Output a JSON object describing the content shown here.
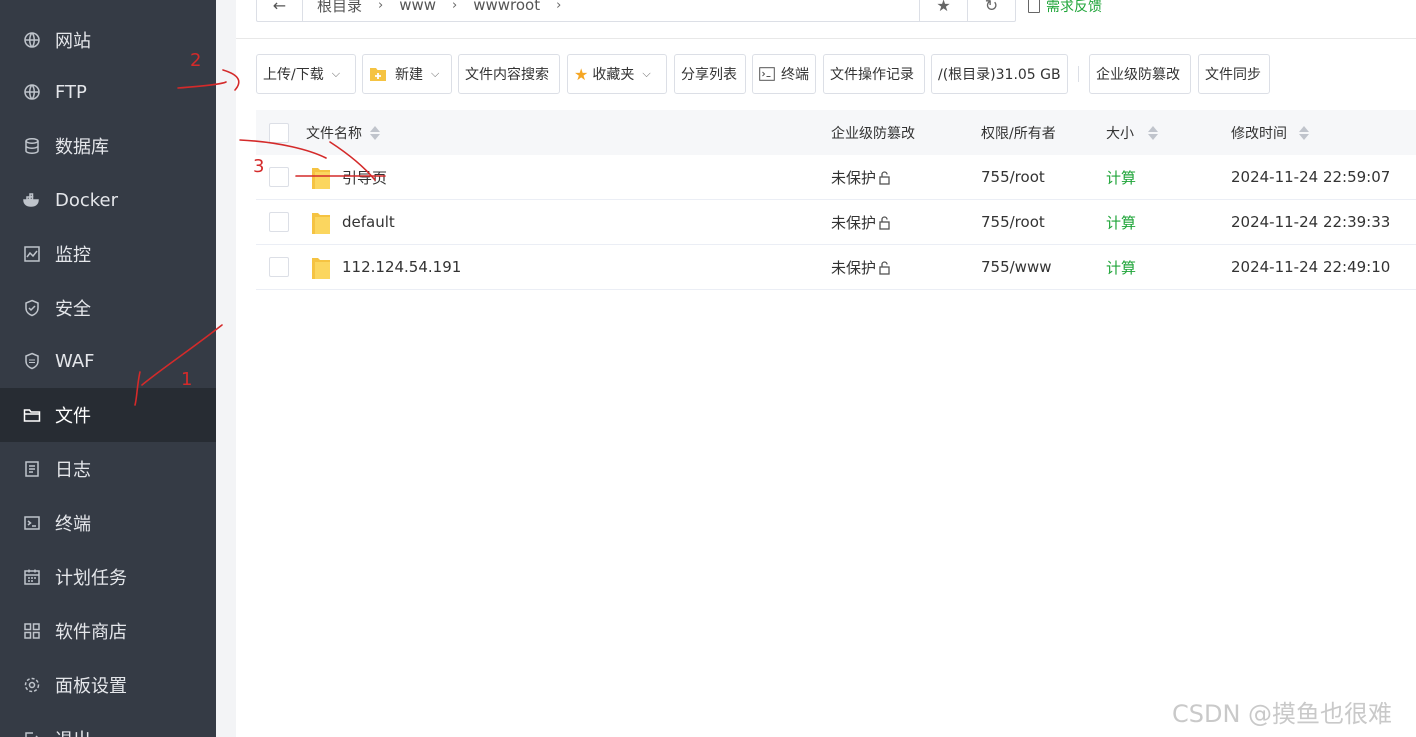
{
  "sidebar": {
    "items": [
      {
        "label": "网站",
        "icon": "globe-icon",
        "active": false
      },
      {
        "label": "FTP",
        "icon": "globe-icon",
        "active": false
      },
      {
        "label": "数据库",
        "icon": "database-icon",
        "active": false
      },
      {
        "label": "Docker",
        "icon": "docker-icon",
        "active": false
      },
      {
        "label": "监控",
        "icon": "monitor-icon",
        "active": false
      },
      {
        "label": "安全",
        "icon": "shield-icon",
        "active": false
      },
      {
        "label": "WAF",
        "icon": "waf-shield-icon",
        "active": false
      },
      {
        "label": "文件",
        "icon": "folder-icon",
        "active": true
      },
      {
        "label": "日志",
        "icon": "log-icon",
        "active": false
      },
      {
        "label": "终端",
        "icon": "terminal-icon",
        "active": false
      },
      {
        "label": "计划任务",
        "icon": "calendar-icon",
        "active": false
      },
      {
        "label": "软件商店",
        "icon": "grid-icon",
        "active": false
      },
      {
        "label": "面板设置",
        "icon": "gear-icon",
        "active": false
      },
      {
        "label": "退出",
        "icon": "logout-icon",
        "active": false
      }
    ]
  },
  "breadcrumb": {
    "back_icon": "←",
    "items": [
      "根目录",
      "www",
      "wwwroot"
    ],
    "separator": "›",
    "star_icon": "★",
    "refresh_icon": "↻"
  },
  "feedback": {
    "label": "需求反馈",
    "color": "#20a53a"
  },
  "toolbar": {
    "upload_download": "上传/下载",
    "new": "新建",
    "content_search": "文件内容搜索",
    "favorites": "收藏夹",
    "share_list": "分享列表",
    "terminal": "终端",
    "operation_log": "文件操作记录",
    "disk": "/(根目录)31.05 GB",
    "tamper_protect": "企业级防篡改",
    "file_sync": "文件同步",
    "caret": "⌵"
  },
  "table": {
    "headers": {
      "name": "文件名称",
      "tamper": "企业级防篡改",
      "perm": "权限/所有者",
      "size": "大小",
      "mtime": "修改时间"
    },
    "rows": [
      {
        "name": "引导页",
        "tamper": "未保护",
        "perm": "755/root",
        "size": "计算",
        "mtime": "2024-11-24 22:59:07"
      },
      {
        "name": "default",
        "tamper": "未保护",
        "perm": "755/root",
        "size": "计算",
        "mtime": "2024-11-24 22:39:33"
      },
      {
        "name": "112.124.54.191",
        "tamper": "未保护",
        "perm": "755/www",
        "size": "计算",
        "mtime": "2024-11-24 22:49:10"
      }
    ]
  },
  "annotations": {
    "one": "1",
    "two": "2",
    "three": "3",
    "color": "#d42a2a"
  },
  "watermark": "CSDN @摸鱼也很难"
}
